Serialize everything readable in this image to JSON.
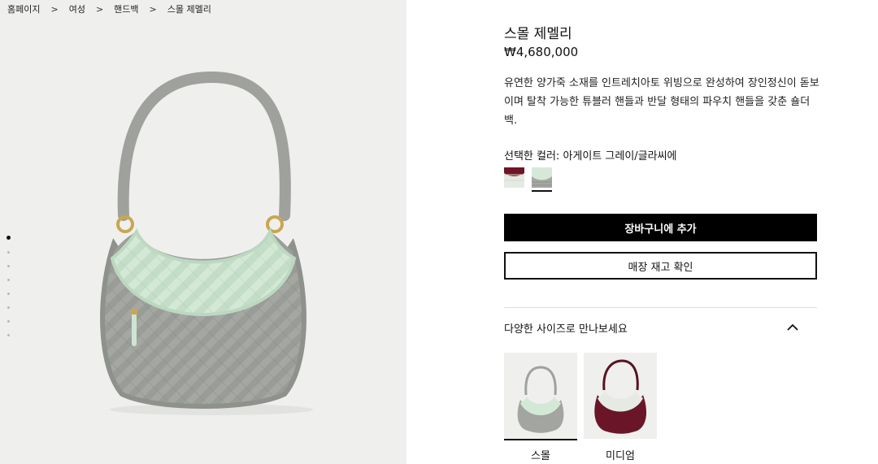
{
  "breadcrumb": [
    "홈페이지",
    "여성",
    "핸드백",
    "스몰 제멜리"
  ],
  "breadcrumb_separator": ">",
  "gallery": {
    "slide_count": 8,
    "active_slide": 1
  },
  "product": {
    "title": "스몰 제멜리",
    "price": "₩4,680,000",
    "description": "유연한 양가죽 소재를 인트레치아토 위빙으로 완성하여 장인정신이 돋보이며 탈착 가능한 튜블러 핸들과 반달 형태의 파우치 핸들을 갖춘 숄더 백.",
    "color_label": "선택한 컬러: 아게이트 그레이/글라씨에",
    "swatches": [
      {
        "name": "burgundy-mint",
        "colors": [
          "#6e1526",
          "#e4ebe3"
        ],
        "selected": false
      },
      {
        "name": "grey-mint",
        "colors": [
          "#a5a7a3",
          "#d6e9d9"
        ],
        "selected": true
      }
    ]
  },
  "buttons": {
    "add_to_cart": "장바구니에 추가",
    "check_store": "매장 재고 확인"
  },
  "sizes_section": {
    "title": "다양한 사이즈로 만나보세요",
    "items": [
      {
        "label": "스몰",
        "selected": true,
        "bag_color": "#a3a5a1",
        "pouch_color": "#d3e9d6"
      },
      {
        "label": "미디엄",
        "selected": false,
        "bag_color": "#6a1628",
        "pouch_color": "#e5eae3"
      }
    ]
  },
  "colors": {
    "gallery_bg": "#eff0ee",
    "primary_button": "#000000",
    "bag_grey": "#a5a7a3",
    "pouch_mint": "#d3e9d6"
  }
}
